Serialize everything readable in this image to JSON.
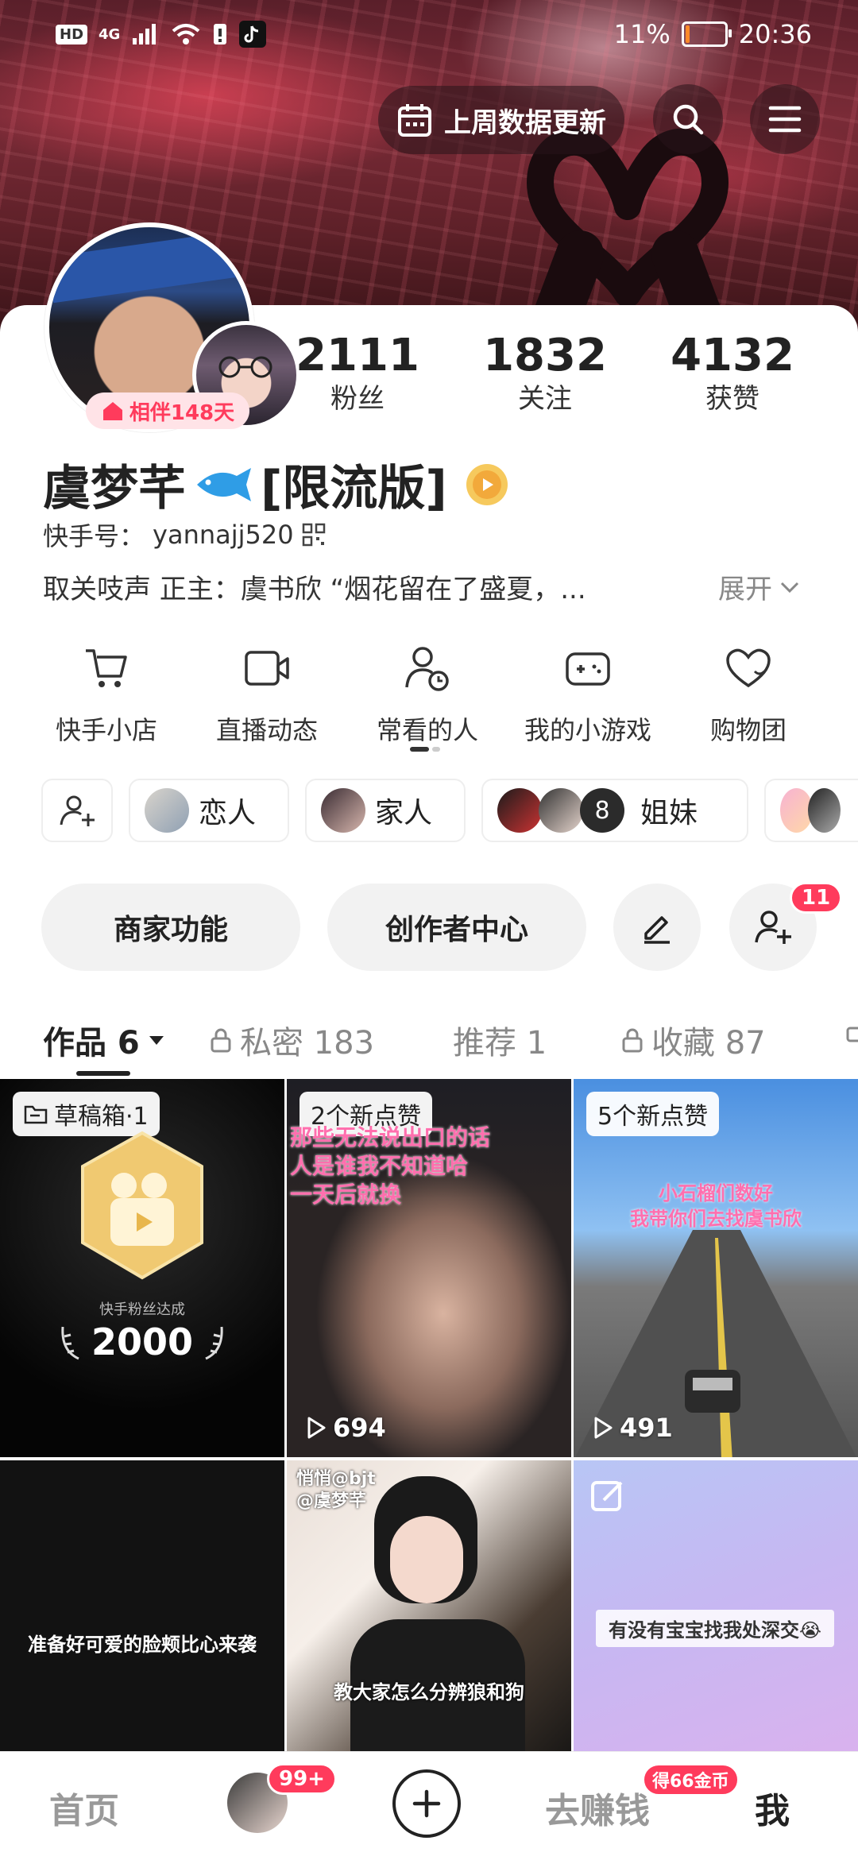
{
  "status_bar": {
    "network": "4G",
    "hd": "HD",
    "battery": "11%",
    "battery_level": 0.11,
    "time": "20:36"
  },
  "header": {
    "update_pill": "上周数据更新"
  },
  "profile": {
    "companion_badge": "相伴148天",
    "stats": [
      {
        "value": "2111",
        "label": "粉丝"
      },
      {
        "value": "1832",
        "label": "关注"
      },
      {
        "value": "4132",
        "label": "获赞"
      }
    ],
    "name": "虞梦芊",
    "name_suffix": "[限流版]",
    "id_label": "快手号：",
    "id_value": "yannajj520",
    "bio": "取关吱声 正主：虞书欣 “烟花留在了盛夏，...",
    "expand": "展开"
  },
  "quick_actions": [
    {
      "label": "快手小店",
      "icon": "cart-icon"
    },
    {
      "label": "直播动态",
      "icon": "camera-icon"
    },
    {
      "label": "常看的人",
      "icon": "person-clock-icon"
    },
    {
      "label": "我的小游戏",
      "icon": "gamepad-icon"
    },
    {
      "label": "购物团",
      "icon": "heart-icon"
    }
  ],
  "circles": [
    {
      "label": "恋人"
    },
    {
      "label": "家人"
    },
    {
      "label": "姐妹",
      "count": "8"
    }
  ],
  "actions": {
    "merchant": "商家功能",
    "creator": "创作者中心",
    "add_friend_badge": "11"
  },
  "tabs": [
    {
      "label": "作品 6",
      "active": true
    },
    {
      "label": "私密 183",
      "locked": true
    },
    {
      "label": "推荐 1"
    },
    {
      "label": "收藏 87",
      "locked": true
    }
  ],
  "grid": [
    {
      "tag": "草稿箱·1",
      "milestone_caption": "快手粉丝达成",
      "milestone_number": "2000"
    },
    {
      "tag": "2个新点赞",
      "overlay_lines": [
        "那些无法说出口的话",
        "人是谁我不知道哈",
        "一天后就换"
      ],
      "plays": "694"
    },
    {
      "tag": "5个新点赞",
      "overlay_lines": [
        "小石榴们数好",
        "我带你们去找虞书欣"
      ],
      "plays": "491"
    },
    {
      "caption": "准备好可爱的脸颊比心来袭"
    },
    {
      "overlay_lines": [
        "悄悄@bjt",
        "@虞梦芊"
      ],
      "caption": "教大家怎么分辨狼和狗"
    },
    {
      "caption": "有没有宝宝找我处深交😭"
    }
  ],
  "bottom_nav": {
    "home": "首页",
    "friends_badge": "99+",
    "earn": "去赚钱",
    "earn_badge": "得66金币",
    "me": "我"
  }
}
